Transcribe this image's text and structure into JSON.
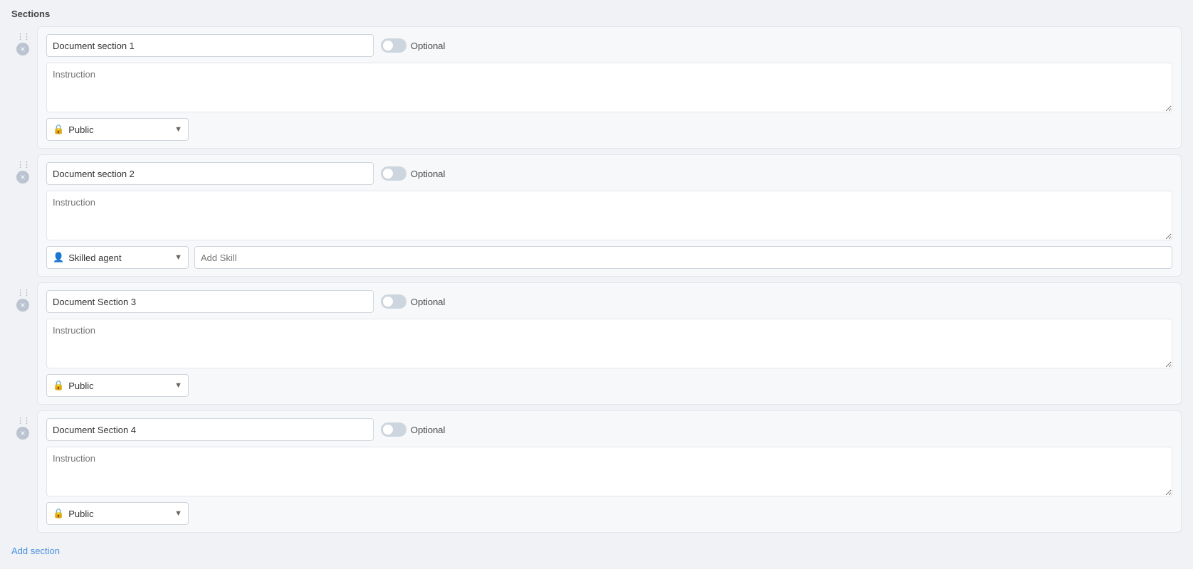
{
  "page": {
    "title": "Sections",
    "add_section_label": "Add section"
  },
  "sections": [
    {
      "id": "section-1",
      "name": "Document section 1",
      "name_placeholder": "",
      "optional": false,
      "optional_label": "Optional",
      "instruction_placeholder": "Instruction",
      "assignee_type": "public",
      "assignee_icon": "🔒",
      "assignee_label": "Public",
      "show_skill": false,
      "skill_placeholder": ""
    },
    {
      "id": "section-2",
      "name": "Document section 2",
      "name_placeholder": "",
      "optional": false,
      "optional_label": "Optional",
      "instruction_placeholder": "Instruction",
      "assignee_type": "skilled",
      "assignee_icon": "👤",
      "assignee_label": "Skilled agent",
      "show_skill": true,
      "skill_placeholder": "Add Skill"
    },
    {
      "id": "section-3",
      "name": "Document Section 3",
      "name_placeholder": "",
      "optional": false,
      "optional_label": "Optional",
      "instruction_placeholder": "Instruction",
      "assignee_type": "public",
      "assignee_icon": "🔒",
      "assignee_label": "Public",
      "show_skill": false,
      "skill_placeholder": ""
    },
    {
      "id": "section-4",
      "name": "Document Section 4",
      "name_placeholder": "",
      "optional": false,
      "optional_label": "Optional",
      "instruction_placeholder": "Instruction",
      "assignee_type": "public",
      "assignee_icon": "🔒",
      "assignee_label": "Public",
      "show_skill": false,
      "skill_placeholder": ""
    }
  ]
}
